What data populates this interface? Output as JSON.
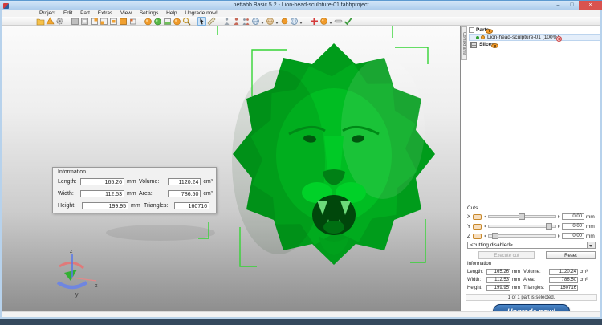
{
  "window": {
    "title": "netfabb Basic 5.2 - Lion-head-sculpture-01.fabbproject",
    "controls": {
      "minimize": "–",
      "maximize": "□",
      "close": "×"
    }
  },
  "menu": {
    "items": [
      "Project",
      "Edit",
      "Part",
      "Extras",
      "View",
      "Settings",
      "Help",
      "Upgrade now!"
    ]
  },
  "toolbar": {
    "icons": [
      "open-folder",
      "import-part",
      "settings-gear",
      "view-cube-1",
      "view-cube-2",
      "view-cube-3",
      "view-cube-4",
      "view-cube-5",
      "view-cube-orange",
      "view-cube-7",
      "repair-sphere",
      "repair-sphere-green",
      "platform-box",
      "sphere-orange",
      "zoom-magnifier",
      "select-cursor",
      "measure-ruler",
      "figure-gray",
      "figure-red",
      "figure-pair",
      "globe-1",
      "globe-2",
      "sphere-small",
      "globe-3",
      "add-plus",
      "action-sphere",
      "collapse-pill",
      "apply-check"
    ]
  },
  "viewport": {
    "model": {
      "name": "Lion head sculpture",
      "color": "#00b81f",
      "bracket_color": "#35d435"
    },
    "axis_labels": {
      "x": "x",
      "y": "y",
      "z": "z"
    },
    "info_panel": {
      "title": "Information",
      "rows": [
        {
          "l1": "Length:",
          "v1": "165.26",
          "u1": "mm",
          "l2": "Volume:",
          "v2": "1120.24",
          "u2": "cm³"
        },
        {
          "l1": "Width:",
          "v1": "112.53",
          "u1": "mm",
          "l2": "Area:",
          "v2": "786.50",
          "u2": "cm²"
        },
        {
          "l1": "Height:",
          "v1": "199.95",
          "u1": "mm",
          "l2": "Triangles:",
          "v2": "160716",
          "u2": ""
        }
      ]
    }
  },
  "context_tab": {
    "label": "Context area"
  },
  "tree": {
    "parts_label": "Parts",
    "part_label": "Lion-head-sculpture-01 (100%)",
    "slices_label": "Slices"
  },
  "cuts": {
    "title": "Cuts",
    "rows": [
      {
        "axis": "X",
        "value": "0.00",
        "unit": "mm",
        "handle_pos": "45%"
      },
      {
        "axis": "Y",
        "value": "0.00",
        "unit": "mm",
        "handle_pos": "86%"
      },
      {
        "axis": "Z",
        "value": "0.00",
        "unit": "mm",
        "handle_pos": "5%"
      }
    ],
    "mode": "<cutting disabled>",
    "execute_label": "Execute cut",
    "reset_label": "Reset"
  },
  "panel_info": {
    "title": "Information",
    "rows": [
      {
        "l1": "Length:",
        "v1": "165.26",
        "u1": "mm",
        "l2": "Volume:",
        "v2": "1120.24",
        "u2": "cm³"
      },
      {
        "l1": "Width:",
        "v1": "112.53",
        "u1": "mm",
        "l2": "Area:",
        "v2": "786.50",
        "u2": "cm²"
      },
      {
        "l1": "Height:",
        "v1": "199.95",
        "u1": "mm",
        "l2": "Triangles:",
        "v2": "160716",
        "u2": ""
      }
    ]
  },
  "status": {
    "selection": "1 of 1 part is selected."
  },
  "upgrade": {
    "label": "Upgrade now!"
  }
}
